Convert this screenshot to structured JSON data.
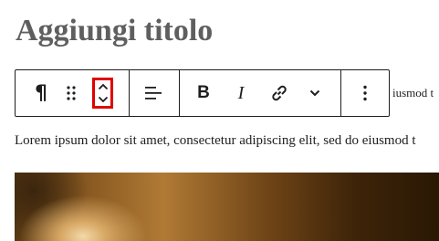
{
  "editor": {
    "title_placeholder": "Aggiungi titolo",
    "toolbar": {
      "paragraph_icon": "¶",
      "drag_icon": "drag-handle-icon",
      "mover_up_icon": "chevron-up-icon",
      "mover_down_icon": "chevron-down-icon",
      "align_icon": "align-left-icon",
      "bold_label": "B",
      "italic_label": "I",
      "link_icon": "link-icon",
      "more_rich_text_icon": "chevron-down-icon",
      "options_icon": "more-vertical-icon",
      "highlight_color": "#e00000"
    },
    "clipped_text": "iusmod t",
    "paragraph_text": "Lorem ipsum dolor sit amet, consectetur adipiscing elit, sed do eiusmod t"
  }
}
